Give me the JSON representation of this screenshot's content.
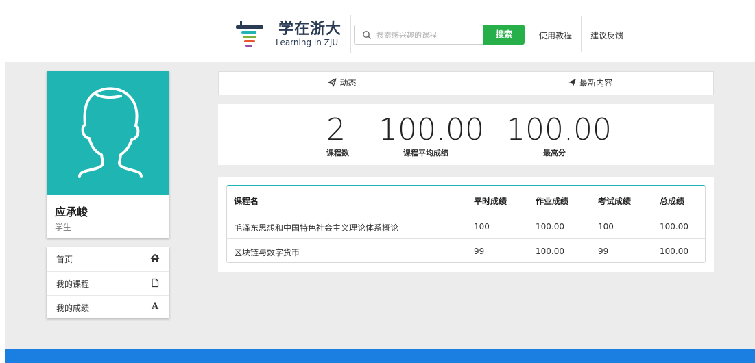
{
  "brand": {
    "title": "学在浙大",
    "subtitle": "Learning in ZJU",
    "colors": {
      "accent": "#1eb5b3",
      "search_button": "#27b04a",
      "footer": "#1a7fe0"
    }
  },
  "header": {
    "search_placeholder": "搜索感兴趣的课程",
    "search_button": "搜索",
    "links": [
      "使用教程",
      "建议反馈"
    ]
  },
  "profile": {
    "name": "应承峻",
    "role": "学生",
    "avatar_icon": "user-silhouette-icon"
  },
  "menu": {
    "items": [
      {
        "label": "首页",
        "icon": "home-icon",
        "glyph": "⌂"
      },
      {
        "label": "我的课程",
        "icon": "file-icon",
        "glyph": ""
      },
      {
        "label": "我的成绩",
        "icon": "grade-letter-icon",
        "glyph": "A"
      }
    ]
  },
  "tabs": [
    {
      "label": "动态",
      "icon": "paper-plane-outline-icon"
    },
    {
      "label": "最新内容",
      "icon": "paper-plane-icon"
    }
  ],
  "stats": [
    {
      "value": "2",
      "label": "课程数"
    },
    {
      "value": "100.00",
      "label": "课程平均成绩"
    },
    {
      "value": "100.00",
      "label": "最高分"
    }
  ],
  "grades": {
    "columns": [
      "课程名",
      "平时成绩",
      "作业成绩",
      "考试成绩",
      "总成绩"
    ],
    "rows": [
      [
        "毛泽东思想和中国特色社会主义理论体系概论",
        "100",
        "100.00",
        "100",
        "100.00"
      ],
      [
        "区块链与数字货币",
        "99",
        "100.00",
        "99",
        "100.00"
      ]
    ]
  }
}
